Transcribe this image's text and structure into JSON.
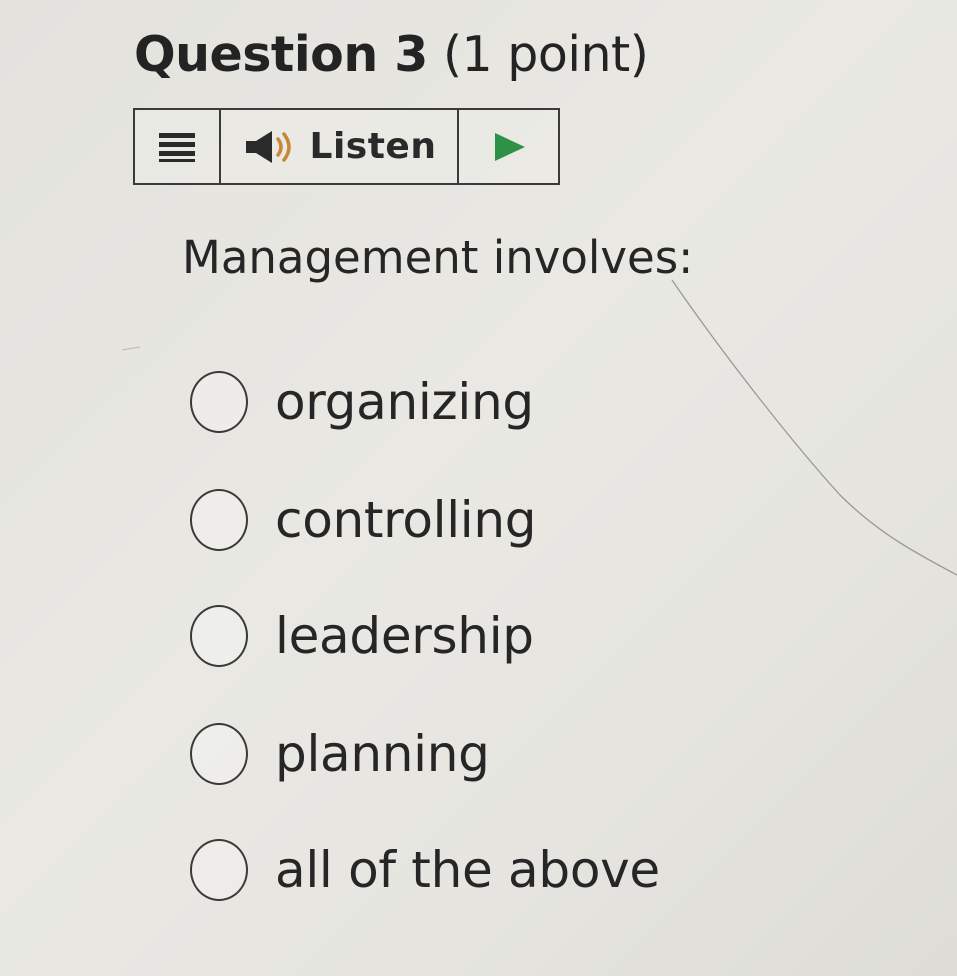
{
  "question": {
    "number_label": "Question 3",
    "points_label": "(1 point)"
  },
  "listen_bar": {
    "menu_icon": "hamburger-menu-icon",
    "speaker_icon": "speaker-icon",
    "listen_label": "Listen",
    "play_icon": "play-icon",
    "accent_color": "#2e9148"
  },
  "prompt": "Management involves:",
  "options": [
    {
      "label": "organizing",
      "selected": false
    },
    {
      "label": "controlling",
      "selected": false
    },
    {
      "label": "leadership",
      "selected": false
    },
    {
      "label": "planning",
      "selected": false
    },
    {
      "label": "all of the above",
      "selected": false
    }
  ]
}
